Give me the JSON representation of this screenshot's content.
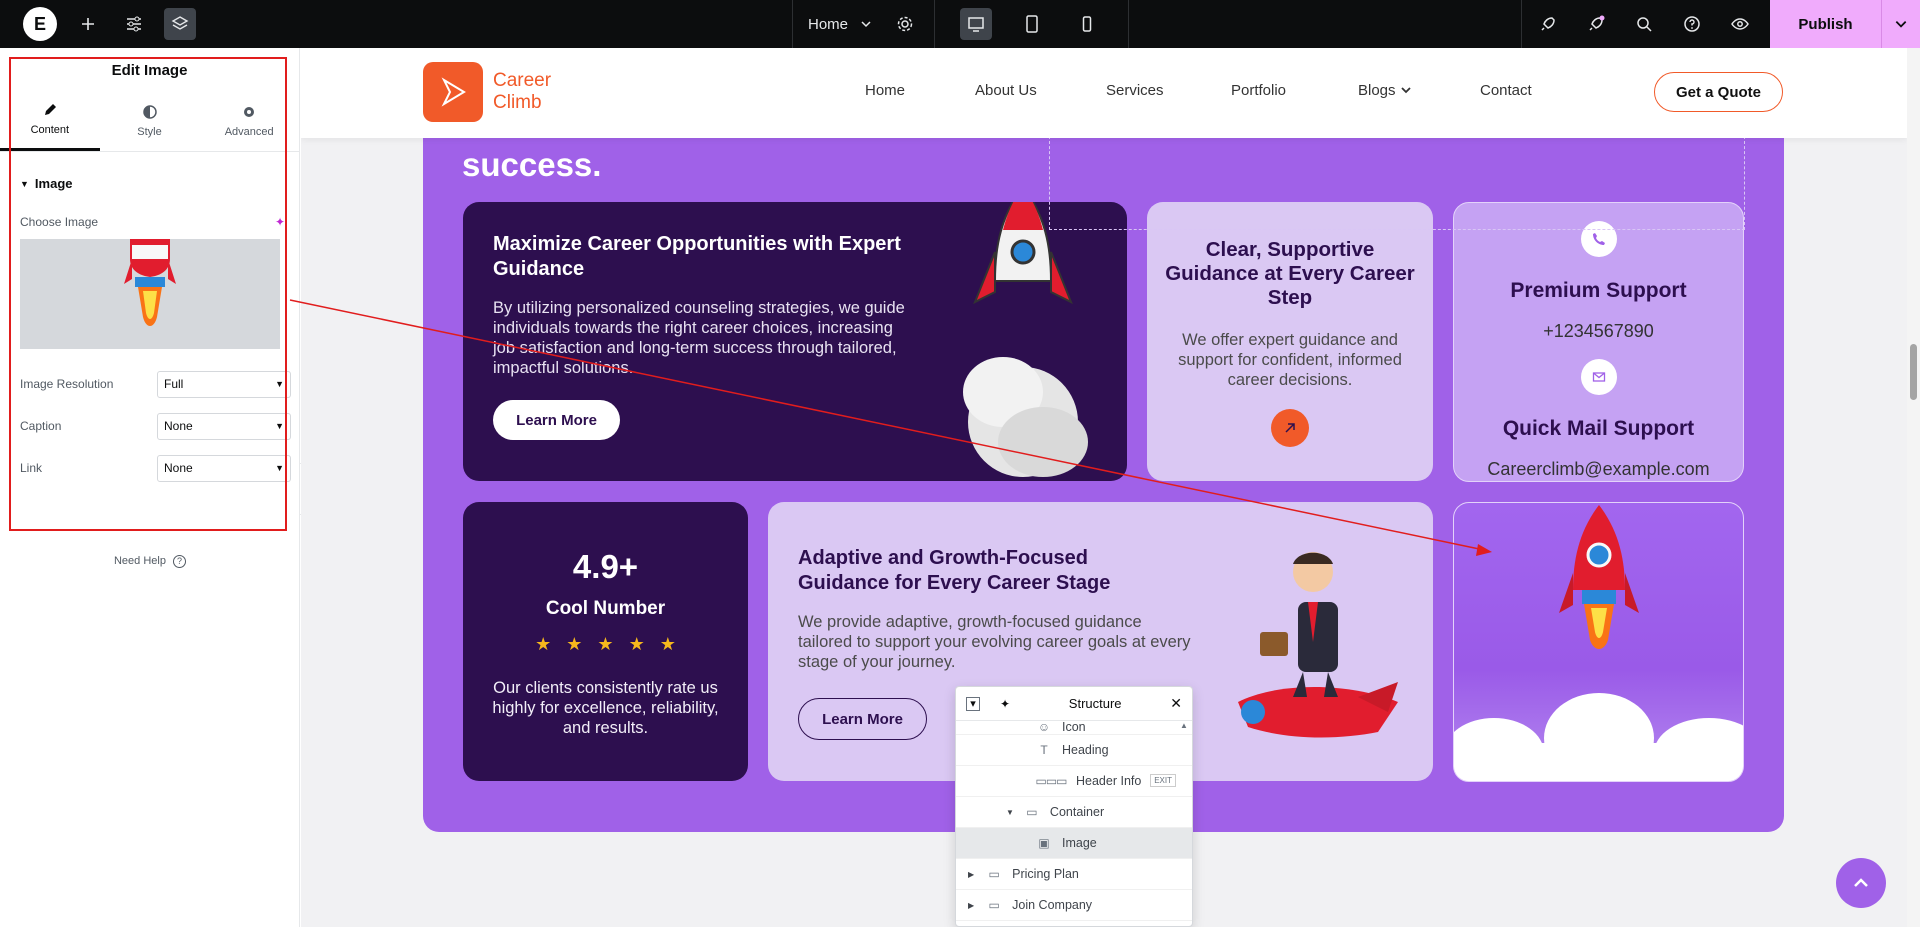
{
  "topbar": {
    "logo_letter": "E",
    "page_name": "Home",
    "publish_label": "Publish",
    "icons": [
      "elementor-logo-icon",
      "plus-icon",
      "sliders-icon",
      "layers-icon",
      "gear-icon",
      "desktop-icon",
      "tablet-icon",
      "mobile-icon",
      "rocket-icon",
      "notifications-icon",
      "search-icon",
      "help-icon",
      "eye-icon",
      "chevron-down-icon"
    ]
  },
  "panel": {
    "title": "Edit Image",
    "tabs": [
      {
        "label": "Content",
        "icon": "pencil-icon"
      },
      {
        "label": "Style",
        "icon": "contrast-icon"
      },
      {
        "label": "Advanced",
        "icon": "gear-icon"
      }
    ],
    "section": "Image",
    "choose_image_label": "Choose Image",
    "controls": [
      {
        "label": "Image Resolution",
        "value": "Full"
      },
      {
        "label": "Caption",
        "value": "None"
      },
      {
        "label": "Link",
        "value": "None"
      }
    ],
    "need_help": "Need Help"
  },
  "site": {
    "logo_line1": "Career",
    "logo_line2": "Climb",
    "nav": [
      "Home",
      "About Us",
      "Services",
      "Portfolio",
      "Blogs",
      "Contact"
    ],
    "quote_button": "Get a Quote",
    "heading_fragment": "success.",
    "card1": {
      "title": "Maximize Career Opportunities with Expert Guidance",
      "body": "By utilizing personalized counseling strategies, we guide individuals towards the right career choices, increasing job satisfaction and long-term success through tailored, impactful solutions.",
      "button": "Learn More"
    },
    "card2": {
      "title": "Clear, Supportive Guidance at Every Career Step",
      "body": "We offer expert guidance and support for confident, informed career decisions."
    },
    "card3": {
      "support_title": "Premium Support",
      "phone": "+1234567890",
      "mail_title": "Quick Mail Support",
      "email": "Careerclimb@example.com"
    },
    "card4": {
      "number": "4.9+",
      "label": "Cool Number",
      "stars": 5,
      "body": "Our clients consistently rate us highly for excellence, reliability, and results."
    },
    "card5": {
      "title": "Adaptive and Growth-Focused Guidance for Every Career Stage",
      "body": "We provide adaptive, growth-focused guidance tailored to support your evolving career goals at every stage of your journey.",
      "button": "Learn More"
    }
  },
  "structure": {
    "title": "Structure",
    "rows": [
      {
        "label": "Icon",
        "icon": "icon-icon"
      },
      {
        "label": "Heading",
        "icon": "heading-icon"
      },
      {
        "label": "Header Info",
        "icon": "header-info-icon",
        "badge": "EXIT"
      },
      {
        "label": "Container",
        "icon": "container-icon"
      },
      {
        "label": "Image",
        "icon": "image-icon"
      },
      {
        "label": "Pricing Plan",
        "icon": "container-icon"
      },
      {
        "label": "Join Company",
        "icon": "container-icon"
      }
    ]
  },
  "colors": {
    "accent_orange": "#f15a29",
    "purple": "#a061e8",
    "dark_purple": "#2d0f4f",
    "light_purple": "#dac8f3",
    "publish_pink": "#f0abfc",
    "annotation_red": "#e11d1d"
  }
}
